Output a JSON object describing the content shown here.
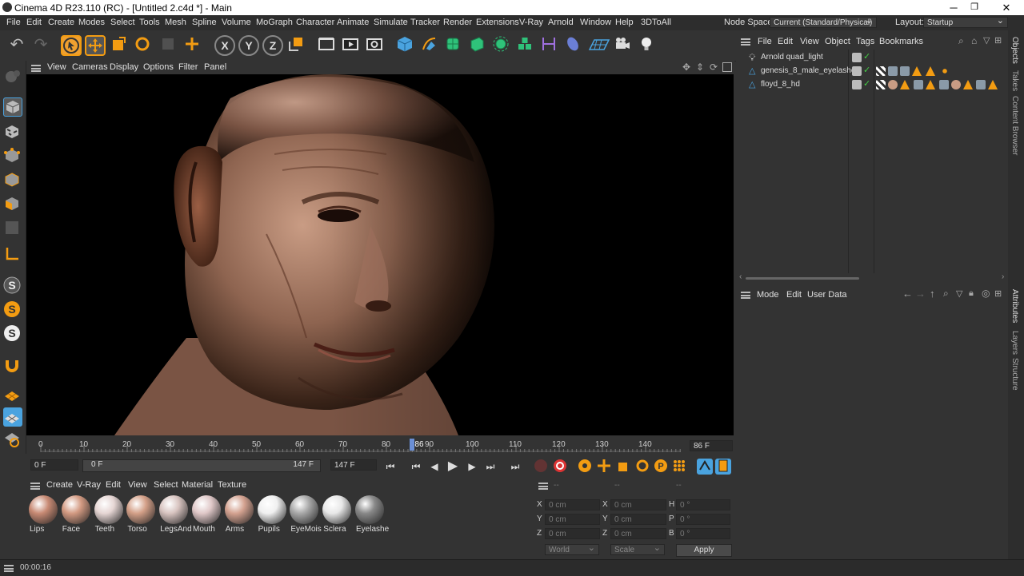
{
  "window": {
    "title": "Cinema 4D R23.110 (RC) - [Untitled 2.c4d *] - Main",
    "minimize": "─",
    "restore": "❐",
    "close": "✕"
  },
  "menubar": {
    "items": [
      "File",
      "Edit",
      "Create",
      "Modes",
      "Select",
      "Tools",
      "Mesh",
      "Spline",
      "Volume",
      "MoGraph",
      "Character",
      "Animate",
      "Simulate",
      "Tracker",
      "Render",
      "Extensions",
      "V-Ray",
      "Arnold",
      "Window",
      "Help",
      "3DToAll"
    ],
    "node_space_label": "Node Space:",
    "node_space_value": "Current (Standard/Physical)",
    "layout_label": "Layout:",
    "layout_value": "Startup"
  },
  "viewport": {
    "menu": [
      "View",
      "Cameras",
      "Display",
      "Options",
      "Filter",
      "Panel"
    ]
  },
  "timeline": {
    "ticks": [
      "0",
      "10",
      "20",
      "30",
      "40",
      "50",
      "60",
      "70",
      "80",
      "90",
      "100",
      "110",
      "120",
      "130",
      "140"
    ],
    "playhead_label": "86",
    "current_frame_field": "86 F",
    "current_frame_value": 86,
    "max_frame_value": 147
  },
  "transport": {
    "start_field": "0 F",
    "range_start": "0 F",
    "range_end": "147 F",
    "end_field": "147 F"
  },
  "materials": {
    "menu": [
      "Create",
      "V-Ray",
      "Edit",
      "View",
      "Select",
      "Material",
      "Texture"
    ],
    "items": [
      {
        "label": "Lips",
        "color": "#c88a74"
      },
      {
        "label": "Face",
        "color": "#d39a82"
      },
      {
        "label": "Teeth",
        "color": "#e6d6d4"
      },
      {
        "label": "Torso",
        "color": "#d4a088"
      },
      {
        "label": "LegsAnd",
        "color": "#d8c4c0"
      },
      {
        "label": "Mouth",
        "color": "#e0c8c8"
      },
      {
        "label": "Arms",
        "color": "#d4a290"
      },
      {
        "label": "Pupils",
        "color": "#f0f0f0"
      },
      {
        "label": "EyeMois",
        "color": "#a8a8a8"
      },
      {
        "label": "Sclera",
        "color": "#e8e8e8"
      },
      {
        "label": "Eyelashe",
        "color": "#888"
      }
    ]
  },
  "coords": {
    "headers": [
      "--",
      "--",
      "--"
    ],
    "rows": [
      {
        "a": "X",
        "av": "0 cm",
        "b": "X",
        "bv": "0 cm",
        "c": "H",
        "cv": "0 °"
      },
      {
        "a": "Y",
        "av": "0 cm",
        "b": "Y",
        "bv": "0 cm",
        "c": "P",
        "cv": "0 °"
      },
      {
        "a": "Z",
        "av": "0 cm",
        "b": "Z",
        "bv": "0 cm",
        "c": "B",
        "cv": "0 °"
      }
    ],
    "space": "World",
    "mode": "Scale",
    "apply": "Apply"
  },
  "status": {
    "time": "00:00:16"
  },
  "objects": {
    "menu": [
      "File",
      "Edit",
      "View",
      "Object",
      "Tags",
      "Bookmarks"
    ],
    "items": [
      {
        "name": "Arnold quad_light"
      },
      {
        "name": "genesis_8_male_eyelashes"
      },
      {
        "name": "floyd_8_hd"
      }
    ]
  },
  "attributes": {
    "menu": [
      "Mode",
      "Edit",
      "User Data"
    ]
  },
  "side_tabs": [
    "Objects",
    "Takes",
    "Content Browser",
    "Attributes",
    "Layers",
    "Structure"
  ],
  "colors": {
    "accent": "#f39c12",
    "bg": "#333333",
    "playhead": "#6b8fd6"
  }
}
